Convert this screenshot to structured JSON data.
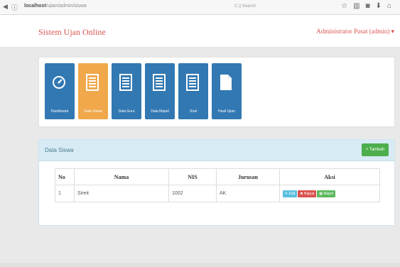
{
  "browser": {
    "url_host": "localhost",
    "url_path": "/ujian/admin/siswa",
    "search_placeholder": "Search",
    "search_prefix": "C ||"
  },
  "header": {
    "title": "Sistem Ujan Online",
    "user_menu": "Administrator Pusat (admin) ▾"
  },
  "tiles": [
    {
      "label": "Dashboard",
      "icon": "gauge-icon",
      "active": false
    },
    {
      "label": "Data Siswa",
      "icon": "list-icon",
      "active": true
    },
    {
      "label": "Data Guru",
      "icon": "list-icon",
      "active": false
    },
    {
      "label": "Data Mapel",
      "icon": "list-icon",
      "active": false
    },
    {
      "label": "Soal",
      "icon": "list-icon",
      "active": false
    },
    {
      "label": "Hasil Ujian",
      "icon": "file-icon",
      "active": false
    }
  ],
  "panel": {
    "title": "Data Siswa",
    "add_label": "+ Tambah"
  },
  "table": {
    "columns": [
      "No",
      "Nama",
      "NIS",
      "Jurusan",
      "Aksi"
    ],
    "rows": [
      {
        "no": "1",
        "nama": "Sireit",
        "nis": "1002",
        "jurusan": "AK"
      }
    ],
    "actions": {
      "edit": "✎ Edit",
      "hapus": "✖ Hapus",
      "mapel": "▦ Mapel"
    }
  },
  "colors": {
    "tile_blue": "#3278b3",
    "tile_active": "#f0a84b",
    "brand_red": "#d9534f",
    "success_green": "#4cae4c"
  }
}
